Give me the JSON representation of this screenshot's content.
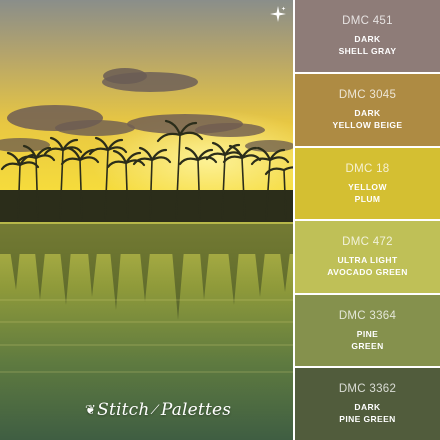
{
  "branding": {
    "logo_text_1": "Stitch",
    "logo_text_2": "Palettes"
  },
  "photo": {
    "scene": "sunset-over-palm-island",
    "icon": "sparkle-icon"
  },
  "swatches": [
    {
      "code": "DMC 451",
      "name_line1": "DARK",
      "name_line2": "SHELL GRAY",
      "color": "#8e7c78"
    },
    {
      "code": "DMC 3045",
      "name_line1": "DARK",
      "name_line2": "YELLOW BEIGE",
      "color": "#ae8b43"
    },
    {
      "code": "DMC 18",
      "name_line1": "YELLOW",
      "name_line2": "PLUM",
      "color": "#d4bf32"
    },
    {
      "code": "DMC 472",
      "name_line1": "ULTRA LIGHT",
      "name_line2": "AVOCADO GREEN",
      "color": "#bfc057"
    },
    {
      "code": "DMC 3364",
      "name_line1": "PINE",
      "name_line2": "GREEN",
      "color": "#85914d"
    },
    {
      "code": "DMC 3362",
      "name_line1": "DARK",
      "name_line2": "PINE GREEN",
      "color": "#515c3c"
    }
  ]
}
